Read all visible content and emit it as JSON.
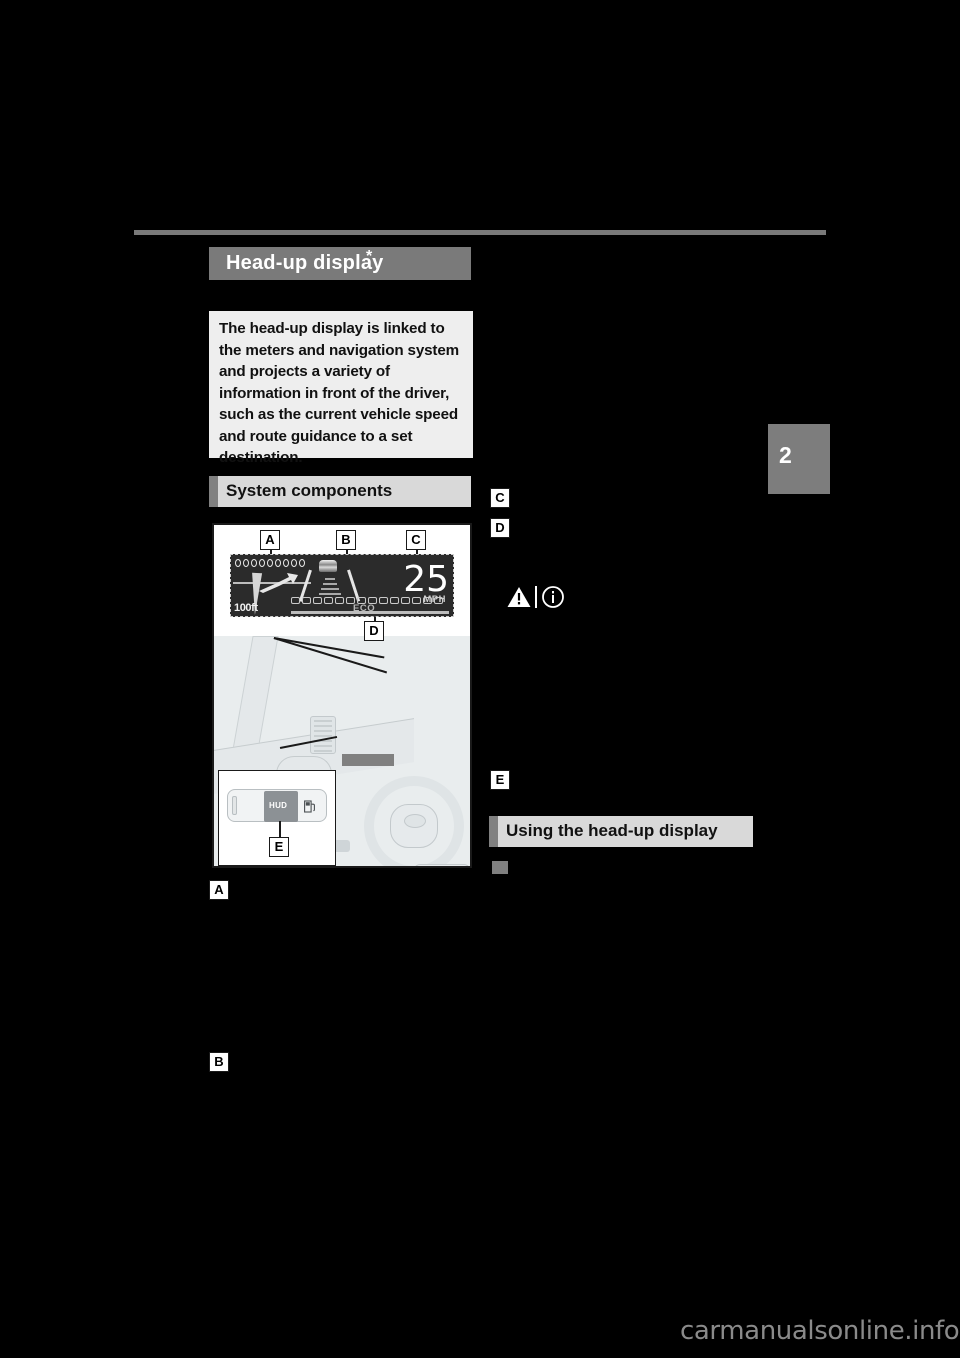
{
  "page": {
    "background_color": "#000000",
    "chapter_number": "2",
    "watermark": "carmanualsonline.info"
  },
  "title": {
    "text": "Head-up display",
    "footnote_marker": "*"
  },
  "intro": {
    "text": "The head-up display is linked to the meters and navigation system and projects a variety of information in front of the driver, such as the current vehicle speed and route guidance to a set destination."
  },
  "sections": [
    {
      "id": "system-components",
      "label": "System components"
    },
    {
      "id": "using-the-head-up-display",
      "label": "Using the head-up display"
    }
  ],
  "illustration": {
    "callouts": [
      "A",
      "B",
      "C",
      "D",
      "E"
    ],
    "hud_display": {
      "segment_a_label": "A",
      "segment_b_label": "B",
      "segment_c_label": "C",
      "segment_d_label": "D",
      "distance": "100ft",
      "speed_value": "25",
      "speed_unit": "MPH",
      "eco_label": "ECO",
      "nav_dot_count": 9,
      "eco_segment_count": 14
    },
    "switch_inset": {
      "button_label": "HUD",
      "callout": "E",
      "fuel_door_icon": "fuel-door-icon"
    }
  },
  "right_column": {
    "callout_c": "C",
    "callout_d": "D",
    "callout_e": "E",
    "notice_icons": [
      "warning-triangle-icon",
      "info-circle-icon"
    ],
    "bullet": "■"
  },
  "colors": {
    "page_bg": "#000000",
    "title_bar": "#7a7a7a",
    "intro_box": "#eeeeee",
    "section_header_accent": "#808080",
    "section_header_body": "#d9d9d9",
    "rule": "#7a7a7a",
    "chapter_tab": "#7d7d7d",
    "hud_panel": "#2b2b2b",
    "watermark": "#8a8a8a"
  }
}
